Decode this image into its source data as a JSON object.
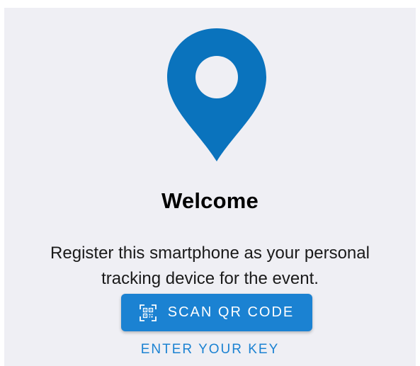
{
  "welcome": {
    "title": "Welcome",
    "description": "Register this smartphone as your personal tracking device for the event.",
    "logo_icon": "location-pin-icon"
  },
  "actions": {
    "scan_label": "SCAN QR CODE",
    "scan_icon": "qr-code-icon",
    "enter_key_label": "ENTER YOUR KEY"
  },
  "colors": {
    "accent": "#1b82d2",
    "pin": "#0a73bd",
    "background": "#efeff4",
    "title_text": "#000000"
  }
}
